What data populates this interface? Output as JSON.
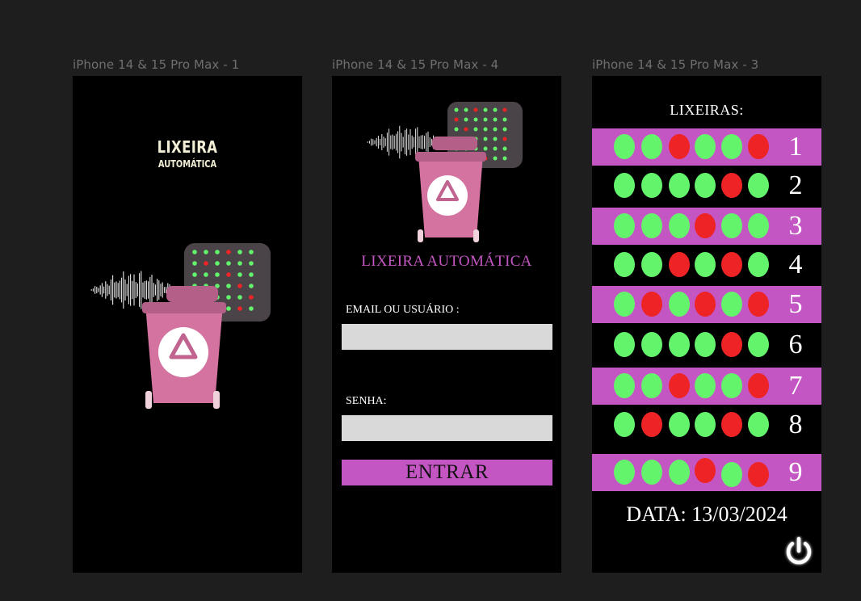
{
  "frames": [
    {
      "label": "iPhone 14 & 15 Pro Max - 1"
    },
    {
      "label": "iPhone 14 & 15 Pro Max - 4"
    },
    {
      "label": "iPhone 14 & 15 Pro Max - 3"
    }
  ],
  "splash": {
    "title": "LIXEIRA",
    "subtitle": "AUTOMÁTICA"
  },
  "login": {
    "app_title": "LIXEIRA AUTOMÁTICA",
    "email_label": "EMAIL OU USUÁRIO :",
    "email_value": "",
    "password_label": "SENHA:",
    "password_value": "",
    "submit_label": "ENTRAR"
  },
  "bins": {
    "heading": "LIXEIRAS:",
    "rows": [
      {
        "number": "1",
        "status": [
          "green",
          "green",
          "red",
          "green",
          "green",
          "red"
        ]
      },
      {
        "number": "2",
        "status": [
          "green",
          "green",
          "green",
          "green",
          "red",
          "green"
        ]
      },
      {
        "number": "3",
        "status": [
          "green",
          "green",
          "green",
          "red",
          "green",
          "green"
        ]
      },
      {
        "number": "4",
        "status": [
          "green",
          "green",
          "red",
          "green",
          "red",
          "green"
        ]
      },
      {
        "number": "5",
        "status": [
          "green",
          "red",
          "green",
          "red",
          "green",
          "red"
        ]
      },
      {
        "number": "6",
        "status": [
          "green",
          "green",
          "green",
          "green",
          "red",
          "green"
        ]
      },
      {
        "number": "7",
        "status": [
          "green",
          "green",
          "red",
          "green",
          "green",
          "red"
        ]
      },
      {
        "number": "8",
        "status": [
          "green",
          "red",
          "green",
          "green",
          "red",
          "green"
        ]
      },
      {
        "number": "9",
        "status": [
          "green",
          "green",
          "green",
          "red",
          "green",
          "red"
        ]
      }
    ],
    "date_text": "DATA: 13/03/2024",
    "power_icon": "power-icon"
  },
  "colors": {
    "accent_pink": "#c456c4",
    "status_green": "#63f46c",
    "status_red": "#ee2326",
    "bin_pink": "#d4739f",
    "led_panel": "#4a4448"
  },
  "icons": [
    "sound-wave-icon",
    "led-matrix-icon",
    "trash-bin-icon",
    "recycle-icon",
    "power-icon"
  ]
}
